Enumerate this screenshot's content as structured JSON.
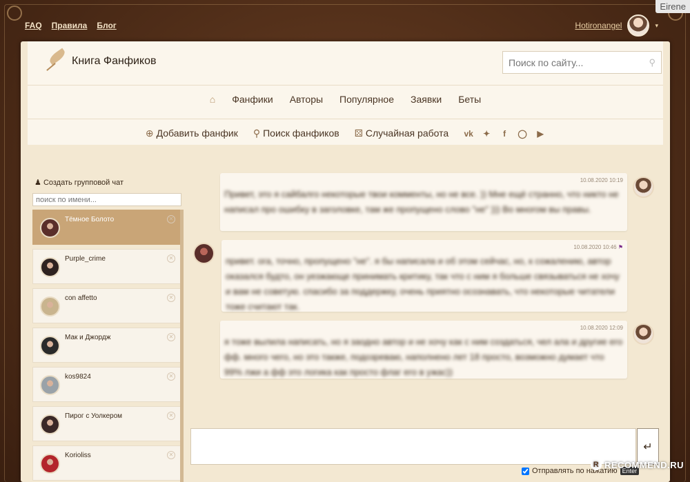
{
  "corner_badge": "Eirene",
  "topbar": {
    "links": [
      "FAQ",
      "Правила",
      "Блог"
    ]
  },
  "user": {
    "name": "Hotironangel",
    "caret": "▾"
  },
  "site": {
    "title": "Книга Фанфиков",
    "search_placeholder": "Поиск по сайту..."
  },
  "nav_primary": {
    "home_icon": "⌂",
    "items": [
      "Фанфики",
      "Авторы",
      "Популярное",
      "Заявки",
      "Беты"
    ]
  },
  "nav_secondary": {
    "add": {
      "icon": "⊕",
      "label": "Добавить фанфик"
    },
    "find": {
      "icon": "⚲",
      "label": "Поиск фанфиков"
    },
    "random": {
      "icon": "⚄",
      "label": "Случайная работа"
    },
    "social_icons": [
      "vk-icon",
      "twitter-icon",
      "facebook-icon",
      "instagram-icon",
      "youtube-icon"
    ]
  },
  "sidebar": {
    "create_group": "Создать групповой чат",
    "search_placeholder": "поиск по имени...",
    "chats": [
      {
        "name": "Тёмное Болото",
        "active": true,
        "color": "#5a2e2a"
      },
      {
        "name": "Purple_crime",
        "active": false,
        "color": "#2e2220"
      },
      {
        "name": "con affetto",
        "active": false,
        "color": "#c9b48e"
      },
      {
        "name": "Мак и Джордж",
        "active": false,
        "color": "#2a2a2a"
      },
      {
        "name": "kos9824",
        "active": false,
        "color": "#9aa2a8"
      },
      {
        "name": "Пирог с Уолкером",
        "active": false,
        "color": "#3a2826"
      },
      {
        "name": "Korioliss",
        "active": false,
        "color": "#b3252b"
      }
    ]
  },
  "messages": [
    {
      "side": "right",
      "time": "10.08.2020 10:19",
      "text": "Привет, это я сайбалго некоторые твои комменты, но не все. )) Мне ещё странно, что никто не написал про ошибку в заголовке, там же пропущено слово \"не\" ))) Во многом вы правы."
    },
    {
      "side": "left",
      "time": "10.08.2020 10:46",
      "text": "привет. ога, точно, пропущено \"не\". я бы написала и об этом сейчас, но, к сожалению, автор оказался будто, он уезжающе принимать критику, так что с ним я больше связываться не хочу и вам не советую. спасибо за поддержку, очень приятно осознавать, что некоторые читатели тоже считают так."
    },
    {
      "side": "right",
      "time": "10.08.2020 12:09",
      "text": "я тоже вылила написать, но я заодно автор и не хочу как с ним создаться, чел ала и другие его фф. много чего, но это также, подозреваю, наполнено лет 18 просто, возможно думает что 99% лжи а фф это логика как просто флаг его в ужас))"
    }
  ],
  "composer": {
    "send_icon": "↵",
    "option_label": "Отправлять по нажатию",
    "key": "Enter"
  },
  "watermark": "RECOMMEND.RU"
}
